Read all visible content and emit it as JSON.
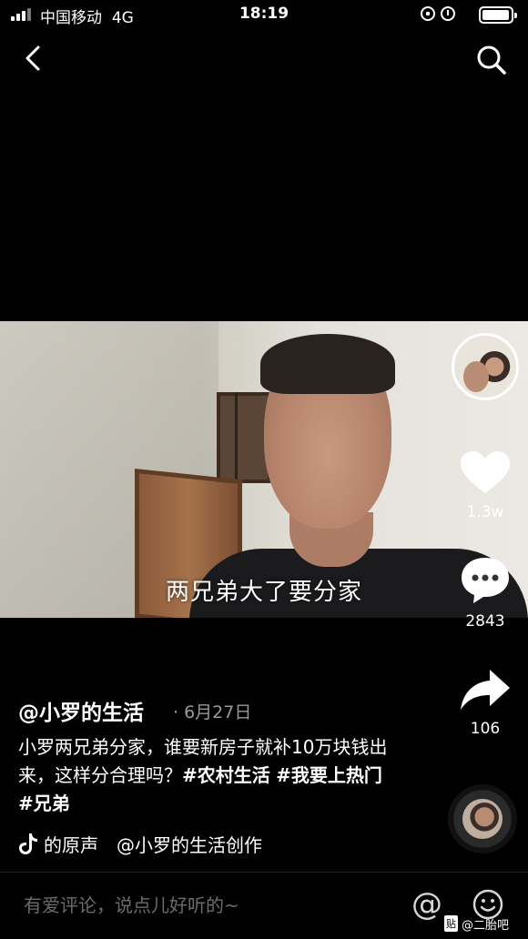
{
  "status_bar": {
    "carrier": "中国移动",
    "network": "4G",
    "time": "18:19"
  },
  "video": {
    "subtitle": "两兄弟大了要分家"
  },
  "actions": {
    "like_count": "1.3w",
    "comment_count": "2843",
    "share_count": "106"
  },
  "post": {
    "author": "@小罗的生活",
    "date": "· 6月27日",
    "caption_text": "小罗两兄弟分家，谁要新房子就补10万块钱出来，这样分合理吗？",
    "hashtags": [
      "#农村生活",
      "#我要上热门",
      "#兄弟"
    ],
    "music": "的原声　@小罗的生活创作"
  },
  "comment_bar": {
    "placeholder": "有爱评论，说点儿好听的~",
    "at_symbol": "@"
  },
  "watermark": {
    "badge": "贴",
    "text": "@二胎吧"
  },
  "icons": {
    "back": "chevron-left-icon",
    "search": "search-icon",
    "like": "heart-icon",
    "comment": "comment-bubble-icon",
    "share": "share-arrow-icon",
    "music": "music-note-icon",
    "emoji": "smiley-icon"
  }
}
